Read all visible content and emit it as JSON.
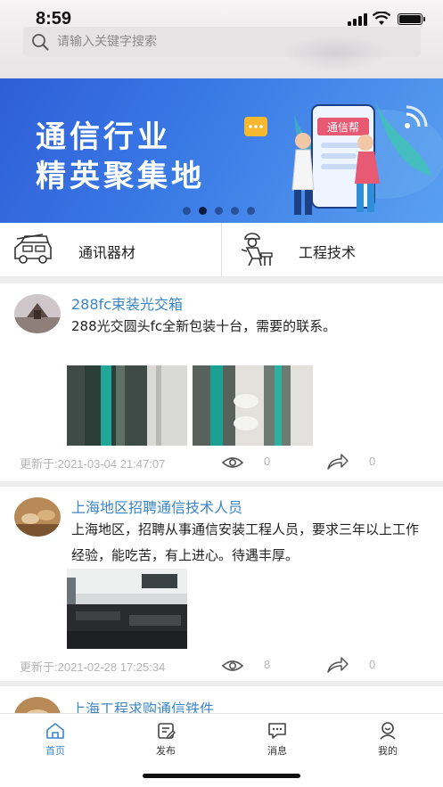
{
  "status": {
    "time": "8:59"
  },
  "search": {
    "placeholder": "请输入关键字搜索"
  },
  "banner": {
    "line1": "通信行业",
    "line2": "精英聚集地",
    "sign_text": "通信帮",
    "active_slide": 2,
    "slide_count": 5
  },
  "categories": [
    {
      "label": "通讯器材",
      "icon": "van-icon"
    },
    {
      "label": "工程技术",
      "icon": "worker-icon"
    }
  ],
  "posts": [
    {
      "title": "288fc束装光交箱",
      "body": "288光交圆头fc全新包装十台，需要的联系。",
      "date": "更新于:2021-03-04 21:47:07",
      "views": "0",
      "shares": "0"
    },
    {
      "title": "上海地区招聘通信技术人员",
      "body": "上海地区，招聘从事通信安装工程人员，要求三年以上工作经验，能吃苦，有上进心。待遇丰厚。",
      "date": "更新于:2021-02-28 17:25:34",
      "views": "8",
      "shares": "0"
    },
    {
      "title": "上海工程求购通信铁件"
    }
  ],
  "tabs": [
    {
      "label": "首页",
      "icon": "home-icon",
      "active": true
    },
    {
      "label": "发布",
      "icon": "publish-icon",
      "active": false
    },
    {
      "label": "消息",
      "icon": "message-icon",
      "active": false
    },
    {
      "label": "我的",
      "icon": "profile-icon",
      "active": false
    }
  ],
  "colors": {
    "accent": "#3b86c8",
    "banner": "#3a7be6",
    "meta": "#b5b5b5"
  }
}
